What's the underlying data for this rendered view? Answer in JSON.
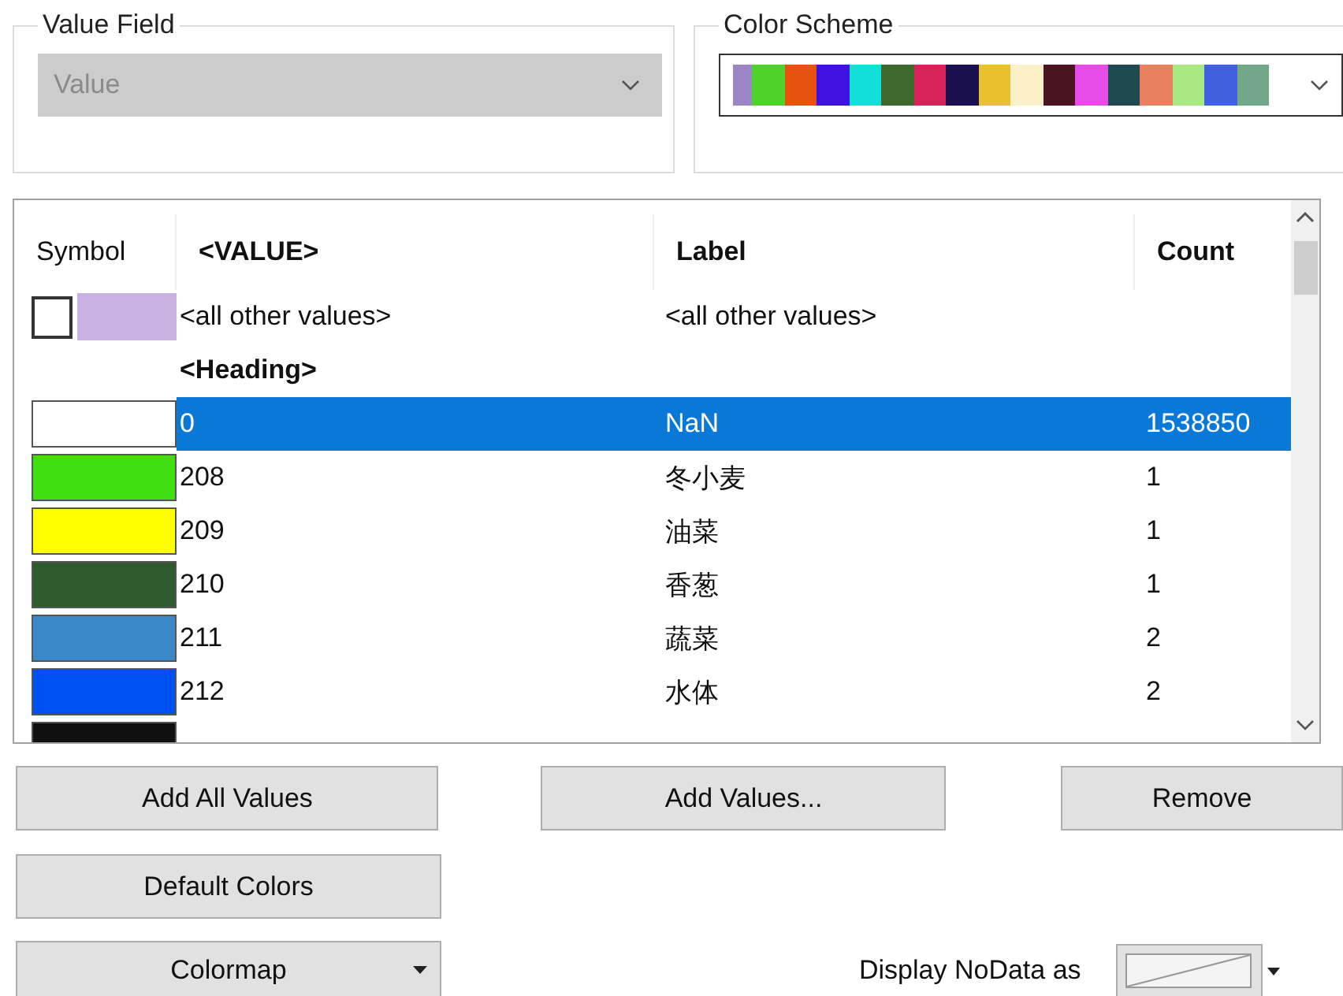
{
  "value_field": {
    "title": "Value Field",
    "value": "Value",
    "disabled": true
  },
  "color_scheme": {
    "title": "Color Scheme",
    "swatches": [
      {
        "color": "#9b85c4"
      },
      {
        "color": "#4fd22c"
      },
      {
        "color": "#e8520f"
      },
      {
        "color": "#4010e0"
      },
      {
        "color": "#10e0d8"
      },
      {
        "color": "#3e6a2e"
      },
      {
        "color": "#d8235a"
      },
      {
        "color": "#1a1050"
      },
      {
        "color": "#e8c030"
      },
      {
        "color": "#fcf0c8"
      },
      {
        "color": "#4a1520"
      },
      {
        "color": "#e84ce8"
      },
      {
        "color": "#1e4a50"
      },
      {
        "color": "#e88060"
      },
      {
        "color": "#a8e880"
      },
      {
        "color": "#4060e0"
      },
      {
        "color": "#70a888"
      }
    ]
  },
  "table": {
    "columns": [
      "Symbol",
      "<VALUE>",
      "Label",
      "Count"
    ],
    "rows": [
      {
        "kind": "other",
        "swatches": [
          {
            "color": "#ffffff"
          },
          {
            "color": "#c8b0e0"
          }
        ],
        "value": "<all other values>",
        "label": "<all other values>",
        "selected": false
      },
      {
        "kind": "heading",
        "value": "<Heading>",
        "selected": false
      },
      {
        "kind": "class",
        "color": "#ffffff",
        "value": "0",
        "label": "NaN",
        "count": "1538850",
        "selected": true
      },
      {
        "kind": "class",
        "color": "#40e010",
        "value": "208",
        "label": "冬小麦",
        "count": "1",
        "selected": false
      },
      {
        "kind": "class",
        "color": "#ffff00",
        "value": "209",
        "label": "油菜",
        "count": "1",
        "selected": false
      },
      {
        "kind": "class",
        "color": "#2e5a2e",
        "value": "210",
        "label": "香葱",
        "count": "1",
        "selected": false
      },
      {
        "kind": "class",
        "color": "#3a88c8",
        "value": "211",
        "label": "蔬菜",
        "count": "2",
        "selected": false
      },
      {
        "kind": "class",
        "color": "#0050f0",
        "value": "212",
        "label": "水体",
        "count": "2",
        "selected": false
      },
      {
        "kind": "class",
        "color": "#101010",
        "selected": false
      }
    ]
  },
  "buttons": [
    "Add All Values",
    "Add Values...",
    "Remove",
    "Default Colors"
  ],
  "colormap_button": "Colormap",
  "nodata": {
    "label": "Display NoData as"
  }
}
